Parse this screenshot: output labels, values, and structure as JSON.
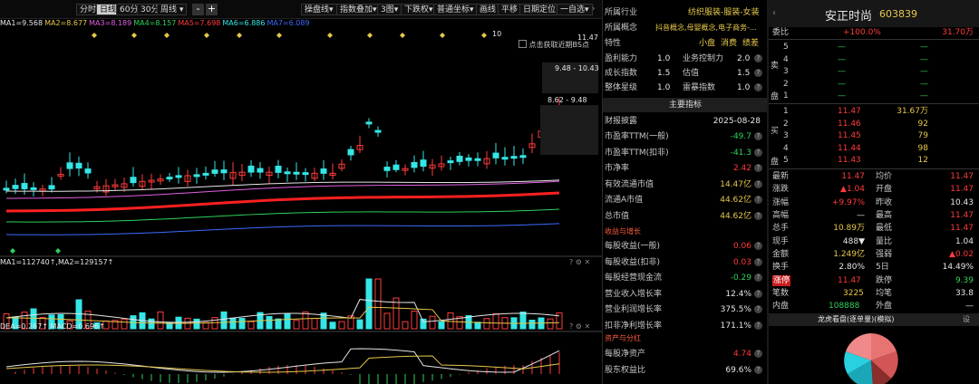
{
  "toolbar": {
    "periods": [
      "分时",
      "日线",
      "60分",
      "30分",
      "周线"
    ],
    "active_period": "日线",
    "zoom_out": "-",
    "zoom_in": "+",
    "tools": [
      "操盘线",
      "指数叠加",
      "3图",
      "下跌权",
      "普通坐标",
      "画线",
      "平移",
      "日期定位",
      "一自选"
    ]
  },
  "ma_legend": [
    {
      "text": "MA1=9.568",
      "color": "#e6e6e6"
    },
    {
      "text": "MA2=8.677",
      "color": "#e6c84a"
    },
    {
      "text": "MA3=8.189",
      "color": "#e060e0"
    },
    {
      "text": "MA4=8.157",
      "color": "#2fd15a"
    },
    {
      "text": "MA5=7.698",
      "color": "#ff3b3b"
    },
    {
      "text": "MA6=6.886",
      "color": "#35e6e6"
    },
    {
      "text": "MA7=6.089",
      "color": "#3b6bff"
    }
  ],
  "chart_labels": {
    "bs_hint": "点击获取近期BS点",
    "price_top": "11.47",
    "price_flag": "10",
    "range1": "9.48 - 10.43",
    "range2": "8.62 - 9.48"
  },
  "vol_legend": "MA1=112740↑,MA2=129157↑",
  "macd_legend": "DEA=0.267↑,MACD=0.696↑",
  "f10": {
    "industry_label": "所属行业",
    "industry_value": "纺织服装-服装-女装",
    "concept_label": "所属概念",
    "concept_value": "抖音概念,母婴概念,电子商务-...",
    "trait_label": "特性",
    "traits": [
      "小盘",
      "消费",
      "绩差"
    ],
    "scores": [
      {
        "a": "盈利能力",
        "av": "1.0",
        "b": "业务控制力",
        "bv": "2.0"
      },
      {
        "a": "成长指数",
        "av": "1.5",
        "b": "估值",
        "bv": "1.5"
      },
      {
        "a": "整体星级",
        "av": "1.0",
        "b": "雷暴指数",
        "bv": "1.0"
      }
    ],
    "main_metrics_title": "主要指标",
    "report_label": "财报披露",
    "report_date": "2025-08-28",
    "metrics": [
      {
        "label": "市盈率TTM(一般)",
        "value": "-49.7",
        "color": "#2fd15a"
      },
      {
        "label": "市盈率TTM(扣非)",
        "value": "-41.3",
        "color": "#2fd15a"
      },
      {
        "label": "市净率",
        "value": "2.42",
        "color": "#ff3b3b"
      },
      {
        "label": "有效流通市值",
        "value": "14.47亿",
        "color": "#e6c84a"
      },
      {
        "label": "流通A市值",
        "value": "44.62亿",
        "color": "#e6c84a"
      },
      {
        "label": "总市值",
        "value": "44.62亿",
        "color": "#e6c84a"
      }
    ],
    "growth_title": "收益与增长",
    "growth": [
      {
        "label": "每股收益(一般)",
        "value": "0.06",
        "color": "#ff3b3b"
      },
      {
        "label": "每股收益(扣非)",
        "value": "0.03",
        "color": "#ff3b3b"
      },
      {
        "label": "每股经营现金流",
        "value": "-0.29",
        "color": "#2fd15a"
      },
      {
        "label": "营业收入增长率",
        "value": "12.4%",
        "color": "#e6e6e6"
      },
      {
        "label": "营业利润增长率",
        "value": "375.5%",
        "color": "#e6e6e6"
      },
      {
        "label": "扣非净利增长率",
        "value": "171.1%",
        "color": "#e6e6e6"
      }
    ],
    "asset_title": "资产与分红",
    "asset": [
      {
        "label": "每股净资产",
        "value": "4.74",
        "color": "#ff3b3b"
      },
      {
        "label": "股东权益比",
        "value": "69.6%",
        "color": "#e6e6e6"
      }
    ]
  },
  "quote": {
    "name": "安正时尚",
    "code": "603839",
    "weibi_label": "委比",
    "weibi_pct": "+100.0%",
    "weibi_vol": "31.70万",
    "sell_side_label": "卖盘",
    "buy_side_label": "买盘",
    "sell": [
      {
        "lvl": "5",
        "price": "—",
        "vol": "—"
      },
      {
        "lvl": "4",
        "price": "—",
        "vol": "—"
      },
      {
        "lvl": "3",
        "price": "—",
        "vol": "—"
      },
      {
        "lvl": "2",
        "price": "—",
        "vol": "—"
      },
      {
        "lvl": "1",
        "price": "—",
        "vol": "—"
      }
    ],
    "buy": [
      {
        "lvl": "1",
        "price": "11.47",
        "vol": "31.67万"
      },
      {
        "lvl": "2",
        "price": "11.46",
        "vol": "92"
      },
      {
        "lvl": "3",
        "price": "11.45",
        "vol": "79"
      },
      {
        "lvl": "4",
        "price": "11.44",
        "vol": "98"
      },
      {
        "lvl": "5",
        "price": "11.43",
        "vol": "12"
      }
    ],
    "stats": [
      {
        "a": "最新",
        "av": "11.47",
        "ac": "#ff3b3b",
        "b": "均价",
        "bv": "11.47",
        "bc": "#ff3b3b"
      },
      {
        "a": "涨跌",
        "av": "▲1.04",
        "ac": "#ff3b3b",
        "b": "开盘",
        "bv": "11.47",
        "bc": "#ff3b3b"
      },
      {
        "a": "涨幅",
        "av": "+9.97%",
        "ac": "#ff3b3b",
        "b": "昨收",
        "bv": "10.43",
        "bc": "#e6e6e6"
      },
      {
        "a": "高幅",
        "av": "—",
        "ac": "#e6e6e6",
        "b": "最高",
        "bv": "11.47",
        "bc": "#ff3b3b"
      },
      {
        "a": "总手",
        "av": "10.89万",
        "ac": "#e6c84a",
        "b": "最低",
        "bv": "11.47",
        "bc": "#ff3b3b"
      },
      {
        "a": "现手",
        "av": "488▼",
        "ac": "#e6e6e6",
        "b": "量比",
        "bv": "1.04",
        "bc": "#e6e6e6"
      },
      {
        "a": "金额",
        "av": "1.249亿",
        "ac": "#e6c84a",
        "b": "强弱",
        "bv": "▲0.02",
        "bc": "#ff3b3b"
      },
      {
        "a": "换手",
        "av": "2.80%",
        "ac": "#e6e6e6",
        "b": "5日",
        "bv": "14.49%",
        "bc": "#e6e6e6"
      }
    ],
    "limit_up_label": "涨停",
    "limit_up_value": "11.47",
    "limit_down_label": "跌停",
    "limit_down_value": "9.39",
    "order_label": "笔数",
    "order_value": "3225",
    "avg_label": "均笔",
    "avg_value": "33.8",
    "inner_label": "内盘",
    "inner_value": "108888",
    "outer_label": "外盘",
    "outer_value": "—",
    "dragon_title": "龙虎看盘(逐单量)(模拟)",
    "settings_label": "设"
  }
}
